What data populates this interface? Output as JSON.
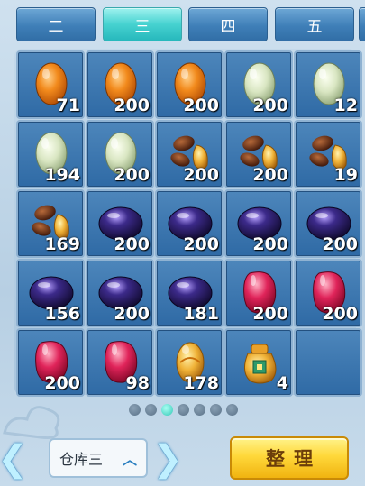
{
  "tabs": [
    {
      "label": "二",
      "active": false
    },
    {
      "label": "三",
      "active": true
    },
    {
      "label": "四",
      "active": false
    },
    {
      "label": "五",
      "active": false
    }
  ],
  "slots": [
    {
      "item": "orange-egg",
      "count": "71"
    },
    {
      "item": "orange-egg",
      "count": "200"
    },
    {
      "item": "orange-egg",
      "count": "200"
    },
    {
      "item": "white-egg",
      "count": "200"
    },
    {
      "item": "white-egg",
      "count": "12"
    },
    {
      "item": "white-egg",
      "count": "194"
    },
    {
      "item": "white-egg",
      "count": "200"
    },
    {
      "item": "gold-beans",
      "count": "200"
    },
    {
      "item": "gold-beans",
      "count": "200"
    },
    {
      "item": "gold-beans",
      "count": "19"
    },
    {
      "item": "gold-beans",
      "count": "169"
    },
    {
      "item": "purple-gem",
      "count": "200"
    },
    {
      "item": "purple-gem",
      "count": "200"
    },
    {
      "item": "purple-gem",
      "count": "200"
    },
    {
      "item": "purple-gem",
      "count": "200"
    },
    {
      "item": "purple-gem",
      "count": "156"
    },
    {
      "item": "purple-gem",
      "count": "200"
    },
    {
      "item": "purple-gem",
      "count": "181"
    },
    {
      "item": "red-gem",
      "count": "200"
    },
    {
      "item": "red-gem",
      "count": "200"
    },
    {
      "item": "red-gem",
      "count": "200"
    },
    {
      "item": "red-gem",
      "count": "98"
    },
    {
      "item": "gold-orb",
      "count": "178"
    },
    {
      "item": "money-bag",
      "count": "4"
    },
    {
      "item": "empty",
      "count": ""
    }
  ],
  "pager": {
    "total": 7,
    "active_index": 2
  },
  "footer": {
    "warehouse_label": "仓库三",
    "sort_label": "整理"
  },
  "colors": {
    "tab": "#3f7fb8",
    "tab_active": "#46d2d0",
    "slot": "#3a77b0",
    "sort_button": "#ffd83a"
  }
}
